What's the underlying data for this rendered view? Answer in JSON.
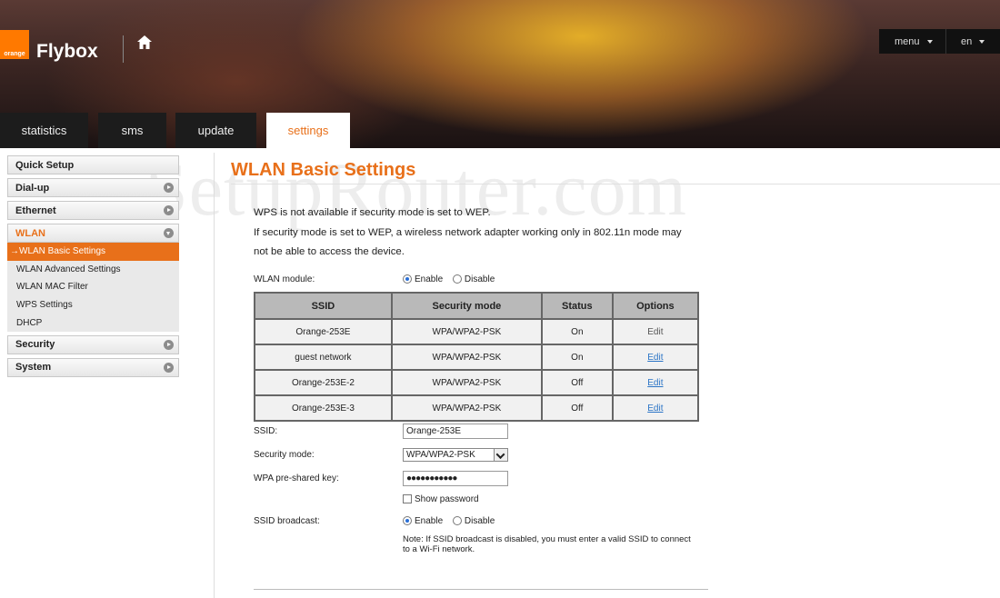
{
  "header": {
    "logo_text": "orange",
    "brand": "Flybox",
    "menu_label": "menu",
    "lang_label": "en",
    "home_icon": "home-icon"
  },
  "tabs": [
    {
      "label": "statistics",
      "active": false
    },
    {
      "label": "sms",
      "active": false
    },
    {
      "label": "update",
      "active": false
    },
    {
      "label": "settings",
      "active": true
    }
  ],
  "watermark": "SetupRouter.com",
  "sidebar": {
    "items": [
      {
        "label": "Quick Setup"
      },
      {
        "label": "Dial-up"
      },
      {
        "label": "Ethernet"
      },
      {
        "label": "WLAN"
      },
      {
        "label": "Security"
      },
      {
        "label": "System"
      }
    ],
    "submenu": [
      {
        "label": "→WLAN Basic Settings",
        "active": true
      },
      {
        "label": "WLAN Advanced Settings"
      },
      {
        "label": "WLAN MAC Filter"
      },
      {
        "label": "WPS Settings"
      },
      {
        "label": "DHCP"
      }
    ]
  },
  "main": {
    "title": "WLAN Basic Settings",
    "note_lines": [
      "WPS is not available if security mode is set to WEP.",
      "If security mode is set to WEP, a wireless network adapter working only in 802.11n mode may",
      "not be able to access the device."
    ],
    "wlan_module": {
      "label": "WLAN module:",
      "enable": "Enable",
      "disable": "Disable",
      "selected": "Enable"
    },
    "table": {
      "headers": [
        "SSID",
        "Security mode",
        "Status",
        "Options"
      ],
      "rows": [
        [
          "Orange-253E",
          "WPA/WPA2-PSK",
          "On",
          "Edit"
        ],
        [
          "guest network",
          "WPA/WPA2-PSK",
          "On",
          "Edit"
        ],
        [
          "Orange-253E-2",
          "WPA/WPA2-PSK",
          "Off",
          "Edit"
        ],
        [
          "Orange-253E-3",
          "WPA/WPA2-PSK",
          "Off",
          "Edit"
        ]
      ]
    },
    "ssid": {
      "label": "SSID:",
      "value": "Orange-253E"
    },
    "security_mode": {
      "label": "Security mode:",
      "value": "WPA/WPA2-PSK"
    },
    "psk": {
      "label": "WPA pre-shared key:",
      "value": "●●●●●●●●●●●"
    },
    "show_password": "Show password",
    "ssid_broadcast": {
      "label": "SSID broadcast:",
      "enable": "Enable",
      "disable": "Disable",
      "selected": "Enable"
    },
    "note": "Note: If SSID broadcast is disabled, you must enter a valid SSID to connect to a Wi-Fi network."
  },
  "colors": {
    "accent": "#e8701a",
    "brand": "#ff7900",
    "link": "#2a74c6"
  }
}
